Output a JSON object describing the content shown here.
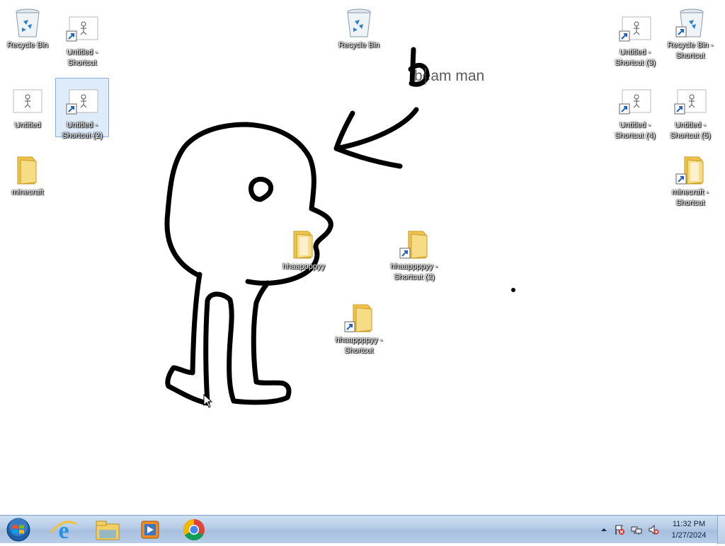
{
  "desktop": {
    "drawing_text": "beam man",
    "icons": [
      {
        "label": "Recycle Bin",
        "type": "recycle-bin",
        "shortcut": false
      },
      {
        "label": "Untitled - Shortcut",
        "type": "image",
        "shortcut": true
      },
      {
        "label": "Untitled",
        "type": "image",
        "shortcut": false
      },
      {
        "label": "Untitled - Shortcut (2)",
        "type": "image",
        "shortcut": true,
        "selected": true
      },
      {
        "label": "minecraft",
        "type": "folder",
        "shortcut": false
      },
      {
        "label": "Recycle Bin",
        "type": "recycle-bin",
        "shortcut": false
      },
      {
        "label": "hhaappppyy",
        "type": "folder",
        "shortcut": false
      },
      {
        "label": "hhaappppyy - Shortcut (2)",
        "type": "folder",
        "shortcut": true
      },
      {
        "label": "hhaappppyy - Shortcut",
        "type": "folder",
        "shortcut": true
      },
      {
        "label": "Untitled - Shortcut (3)",
        "type": "image",
        "shortcut": true
      },
      {
        "label": "Recycle Bin - Shortcut",
        "type": "recycle-bin",
        "shortcut": true
      },
      {
        "label": "Untitled - Shortcut (4)",
        "type": "image",
        "shortcut": true
      },
      {
        "label": "Untitled - Shortcut (5)",
        "type": "image",
        "shortcut": true
      },
      {
        "label": "minecraft - Shortcut",
        "type": "folder",
        "shortcut": true
      }
    ]
  },
  "taskbar": {
    "pinned": [
      {
        "name": "internet-explorer-icon"
      },
      {
        "name": "file-explorer-icon"
      },
      {
        "name": "media-player-icon"
      },
      {
        "name": "chrome-icon"
      }
    ],
    "tray": {
      "icons": [
        "show-hidden-icons-arrow",
        "action-center-flag-icon",
        "network-icon",
        "volume-muted-icon"
      ],
      "time": "11:32 PM",
      "date": "1/27/2024"
    }
  },
  "colors": {
    "taskbar": "#b4cbe6",
    "selection": "#84acdd",
    "folder": "#f5cf5a"
  }
}
